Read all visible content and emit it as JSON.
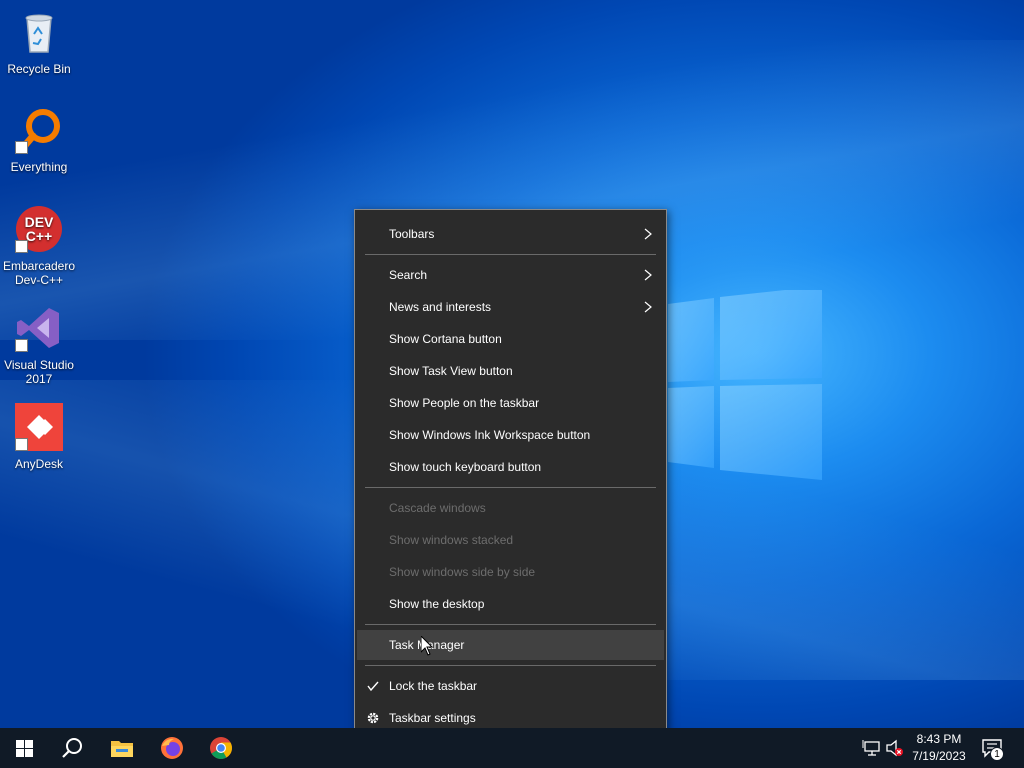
{
  "desktop": {
    "icons": [
      {
        "label": "Recycle Bin",
        "icon": "recycle-bin-icon"
      },
      {
        "label": "Everything",
        "icon": "everything-search-icon"
      },
      {
        "label": "Embarcadero Dev-C++",
        "icon": "devcpp-icon",
        "logo_text": "DEV C++"
      },
      {
        "label": "Visual Studio 2017",
        "icon": "visual-studio-icon"
      },
      {
        "label": "AnyDesk",
        "icon": "anydesk-icon"
      }
    ]
  },
  "context_menu": {
    "items": {
      "toolbars": "Toolbars",
      "search": "Search",
      "news": "News and interests",
      "cortana": "Show Cortana button",
      "taskview": "Show Task View button",
      "people": "Show People on the taskbar",
      "ink": "Show Windows Ink Workspace button",
      "touch_keyboard": "Show touch keyboard button",
      "cascade": "Cascade windows",
      "stacked": "Show windows stacked",
      "side_by_side": "Show windows side by side",
      "show_desktop": "Show the desktop",
      "task_manager": "Task Manager",
      "lock": "Lock the taskbar",
      "settings": "Taskbar settings"
    },
    "hovered": "Task Manager",
    "checked": "Lock the taskbar"
  },
  "taskbar": {
    "pinned": [
      "start-icon",
      "search-icon",
      "file-explorer-icon",
      "firefox-icon",
      "chrome-icon"
    ],
    "tray": [
      "network-icon",
      "volume-muted-icon"
    ],
    "clock": {
      "time": "8:43 PM",
      "date": "7/19/2023"
    },
    "notification_count": "1"
  },
  "colors": {
    "menu_bg": "#2b2b2b",
    "menu_hover": "#414141",
    "taskbar_bg": "#101a26",
    "disabled_text": "#6d6d6d"
  }
}
